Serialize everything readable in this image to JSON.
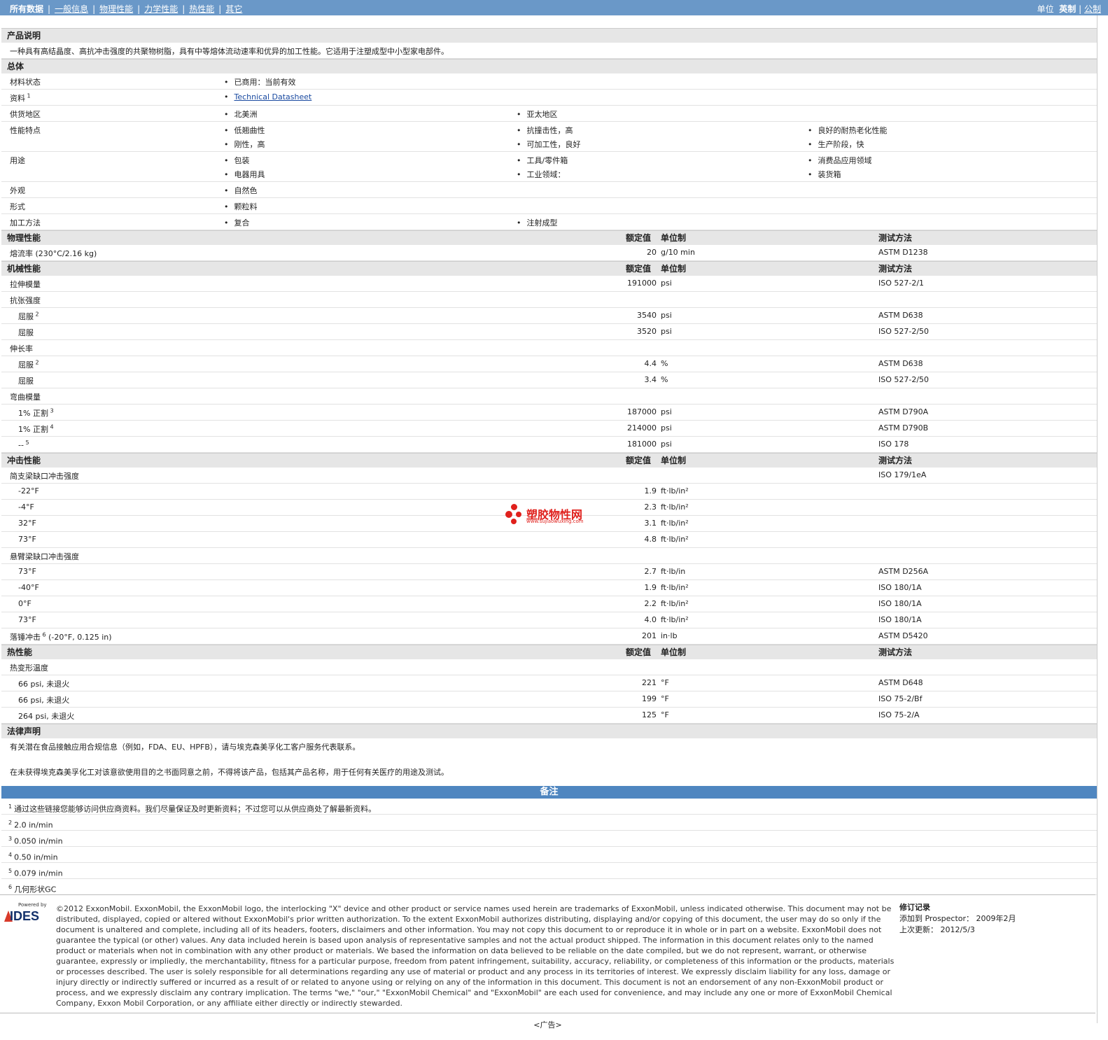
{
  "nav": {
    "active": "所有数据",
    "links": [
      "一般信息",
      "物理性能",
      "力学性能",
      "热性能",
      "其它"
    ]
  },
  "units": {
    "label": "单位",
    "selected": "英制",
    "other": "公制"
  },
  "headers": {
    "rated": "额定值",
    "unit": "单位制",
    "method": "测试方法"
  },
  "description": {
    "title": "产品说明",
    "text": "一种具有高结晶度、高抗冲击强度的共聚物树脂，具有中等熔体流动速率和优异的加工性能。它适用于注塑成型中小型家电部件。"
  },
  "general": {
    "title": "总体",
    "rows": [
      {
        "label": "材料状态",
        "cols": [
          [
            "已商用：当前有效"
          ]
        ]
      },
      {
        "label": "资料",
        "sup": "1",
        "cols": [
          [
            "Technical Datasheet"
          ]
        ],
        "link": true
      },
      {
        "label": "供货地区",
        "cols": [
          [
            "北美洲"
          ],
          [
            "亚太地区"
          ]
        ]
      },
      {
        "label": "性能特点",
        "cols": [
          [
            "低翘曲性",
            "刚性，高"
          ],
          [
            "抗撞击性，高",
            "可加工性，良好"
          ],
          [
            "良好的耐热老化性能",
            "生产阶段，快"
          ]
        ]
      },
      {
        "label": "用途",
        "cols": [
          [
            "包装",
            "电器用具"
          ],
          [
            "工具/零件箱",
            "工业领域："
          ],
          [
            "消费品应用领域",
            "装货箱"
          ]
        ]
      },
      {
        "label": "外观",
        "cols": [
          [
            "自然色"
          ]
        ]
      },
      {
        "label": "形式",
        "cols": [
          [
            "颗粒料"
          ]
        ]
      },
      {
        "label": "加工方法",
        "cols": [
          [
            "复合"
          ],
          [
            "注射成型"
          ]
        ]
      }
    ]
  },
  "physical": {
    "title": "物理性能",
    "rows": [
      {
        "label": "熔流率",
        "cond": "(230°C/2.16 kg)",
        "value": "20",
        "unit": "g/10 min",
        "method": "ASTM D1238"
      }
    ]
  },
  "mechanical": {
    "title": "机械性能",
    "rows": [
      {
        "label": "拉伸模量",
        "value": "191000",
        "unit": "psi",
        "method": "ISO 527-2/1"
      },
      {
        "label": "抗张强度"
      },
      {
        "label": "屈服",
        "sup": "2",
        "indent": true,
        "value": "3540",
        "unit": "psi",
        "method": "ASTM D638"
      },
      {
        "label": "屈服",
        "indent": true,
        "value": "3520",
        "unit": "psi",
        "method": "ISO 527-2/50"
      },
      {
        "label": "伸长率"
      },
      {
        "label": "屈服",
        "sup": "2",
        "indent": true,
        "value": "4.4",
        "unit": "%",
        "method": "ASTM D638"
      },
      {
        "label": "屈服",
        "indent": true,
        "value": "3.4",
        "unit": "%",
        "method": "ISO 527-2/50"
      },
      {
        "label": "弯曲模量"
      },
      {
        "label": "1% 正割",
        "sup": "3",
        "indent": true,
        "value": "187000",
        "unit": "psi",
        "method": "ASTM D790A"
      },
      {
        "label": "1% 正割",
        "sup": "4",
        "indent": true,
        "value": "214000",
        "unit": "psi",
        "method": "ASTM D790B"
      },
      {
        "label": "--",
        "sup": "5",
        "indent": true,
        "value": "181000",
        "unit": "psi",
        "method": "ISO 178"
      }
    ]
  },
  "impact": {
    "title": "冲击性能",
    "rows": [
      {
        "label": "简支梁缺口冲击强度",
        "method": "ISO 179/1eA"
      },
      {
        "label": "-22°F",
        "indent": true,
        "value": "1.9",
        "unit": "ft·lb/in²"
      },
      {
        "label": "-4°F",
        "indent": true,
        "value": "2.3",
        "unit": "ft·lb/in²"
      },
      {
        "label": "32°F",
        "indent": true,
        "value": "3.1",
        "unit": "ft·lb/in²"
      },
      {
        "label": "73°F",
        "indent": true,
        "value": "4.8",
        "unit": "ft·lb/in²"
      },
      {
        "label": "悬臂梁缺口冲击强度"
      },
      {
        "label": "73°F",
        "indent": true,
        "value": "2.7",
        "unit": "ft·lb/in",
        "method": "ASTM D256A"
      },
      {
        "label": "-40°F",
        "indent": true,
        "value": "1.9",
        "unit": "ft·lb/in²",
        "method": "ISO 180/1A"
      },
      {
        "label": "0°F",
        "indent": true,
        "value": "2.2",
        "unit": "ft·lb/in²",
        "method": "ISO 180/1A"
      },
      {
        "label": "73°F",
        "indent": true,
        "value": "4.0",
        "unit": "ft·lb/in²",
        "method": "ISO 180/1A"
      },
      {
        "label": "落锤冲击",
        "sup": "6",
        "cond": "(-20°F, 0.125 in)",
        "value": "201",
        "unit": "in·lb",
        "method": "ASTM D5420"
      }
    ]
  },
  "thermal": {
    "title": "热性能",
    "rows": [
      {
        "label": "热变形温度"
      },
      {
        "label": "66 psi, 未退火",
        "indent": true,
        "value": "221",
        "unit": "°F",
        "method": "ASTM D648"
      },
      {
        "label": "66 psi, 未退火",
        "indent": true,
        "value": "199",
        "unit": "°F",
        "method": "ISO 75-2/Bf"
      },
      {
        "label": "264 psi, 未退火",
        "indent": true,
        "value": "125",
        "unit": "°F",
        "method": "ISO 75-2/A"
      }
    ]
  },
  "legal": {
    "title": "法律声明",
    "p1": "有关潜在食品接触应用合规信息（例如，FDA、EU、HPFB），请与埃克森美孚化工客户服务代表联系。",
    "p2": "在未获得埃克森美孚化工对该意欲使用目的之书面同意之前，不得将该产品，包括其产品名称，用于任何有关医疗的用途及测试。"
  },
  "notes": {
    "title": "备注",
    "items": [
      {
        "n": "1",
        "text": "通过这些链接您能够访问供应商资料。我们尽量保证及时更新资料；不过您可以从供应商处了解最新资料。"
      },
      {
        "n": "2",
        "text": "2.0 in/min"
      },
      {
        "n": "3",
        "text": "0.050 in/min"
      },
      {
        "n": "4",
        "text": "0.50 in/min"
      },
      {
        "n": "5",
        "text": "0.079 in/min"
      },
      {
        "n": "6",
        "text": "几何形状GC"
      }
    ]
  },
  "footer": {
    "powered": "Powered by",
    "logo": "IDES",
    "copyright": "©2012 ExxonMobil. ExxonMobil, the ExxonMobil logo, the interlocking \"X\" device and other product or service names used herein are trademarks of ExxonMobil, unless indicated otherwise. This document may not be distributed, displayed, copied or altered without ExxonMobil's prior written authorization. To the extent ExxonMobil authorizes distributing, displaying and/or copying of this document, the user may do so only if the document is unaltered and complete, including all of its headers, footers, disclaimers and other information. You may not copy this document to or reproduce it in whole or in part on a website. ExxonMobil does not guarantee the typical (or other) values. Any data included herein is based upon analysis of representative samples and not the actual product shipped. The information in this document relates only to the named product or materials when not in combination with any other product or materials. We based the information on data believed to be reliable on the date compiled, but we do not represent, warrant, or otherwise guarantee, expressly or impliedly, the merchantability, fitness for a particular purpose, freedom from patent infringement, suitability, accuracy, reliability, or completeness of this information or the products, materials or processes described. The user is solely responsible for all determinations regarding any use of material or product and any process in its territories of interest. We expressly disclaim liability for any loss, damage or injury directly or indirectly suffered or incurred as a result of or related to anyone using or relying on any of the information in this document. This document is not an endorsement of any non-ExxonMobil product or process, and we expressly disclaim any contrary implication. The terms \"we,\" \"our,\" \"ExxonMobil Chemical\" and \"ExxonMobil\" are each used for convenience, and may include any one or more of ExxonMobil Chemical Company, Exxon Mobil Corporation, or any affiliate either directly or indirectly stewarded.",
    "rev_title": "修订记录",
    "added": "添加到 Prospector： 2009年2月",
    "updated": "上次更新： 2012/5/3",
    "ad": "<广告>"
  },
  "watermark": {
    "name": "塑胶物性网",
    "url": "www.sujiaowuxing.com"
  }
}
